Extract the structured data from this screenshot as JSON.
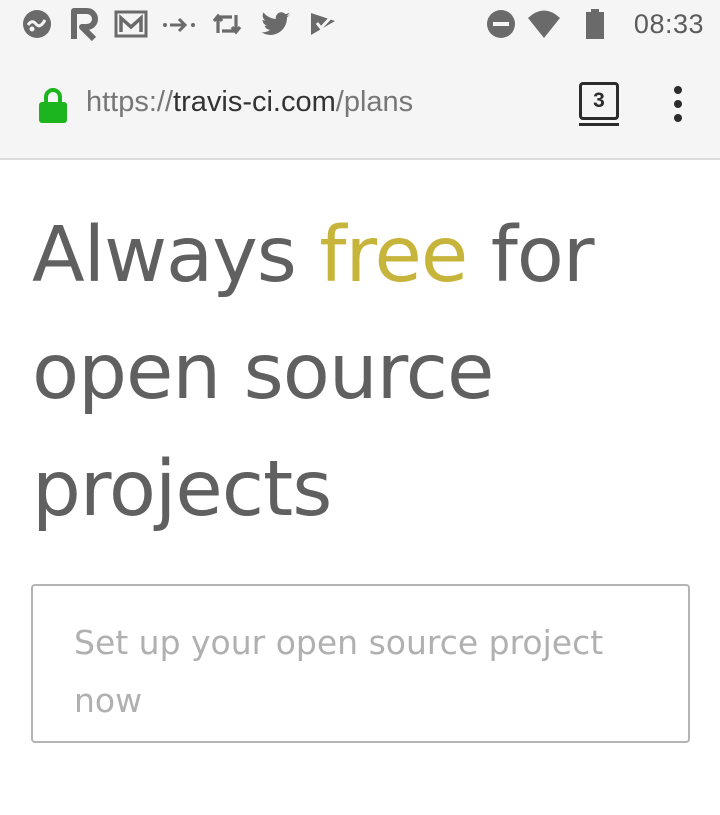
{
  "status_bar": {
    "time": "08:33",
    "left_icons": [
      "app-icon",
      "r-app-icon",
      "gmail-icon",
      "forward-arrow-icon",
      "retweet-icon",
      "twitter-icon",
      "checkmark-app-icon"
    ],
    "right_icons": [
      "do-not-disturb-icon",
      "wifi-icon",
      "battery-icon"
    ]
  },
  "browser": {
    "url_scheme": "https://",
    "url_host": "travis-ci.com",
    "url_path": "/plans",
    "tab_count": "3",
    "lock_color": "#1db51d"
  },
  "content": {
    "headline_before": "Always ",
    "headline_highlight": "free",
    "headline_after_1": " for",
    "headline_line2": "open source",
    "headline_line3": "projects",
    "highlight_color": "#c7b43a",
    "cta_label": "Set up your open source project now"
  }
}
